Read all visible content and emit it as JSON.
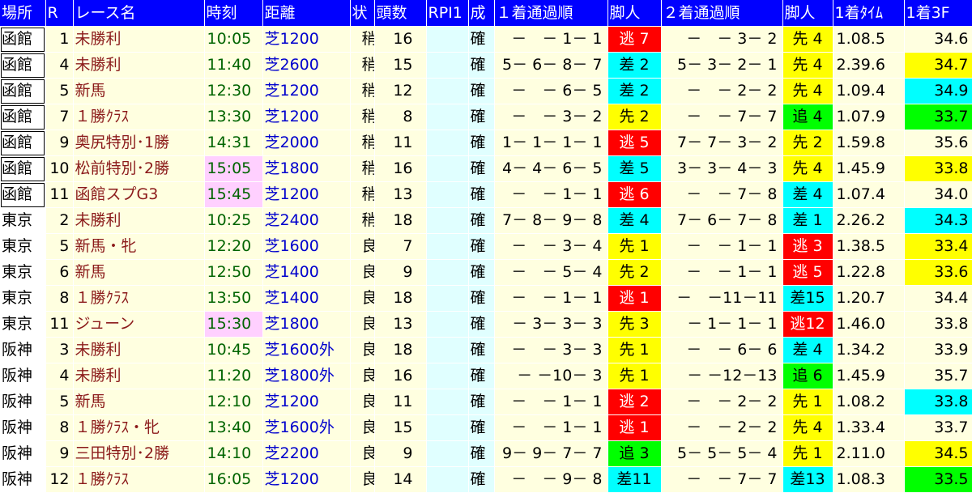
{
  "headers": [
    "場所",
    "R",
    "レース名",
    "時刻",
    "距離",
    "状",
    "頭数",
    "RPI1",
    "成",
    "１着通過順",
    "脚人",
    "２着通過順",
    "脚人",
    "1着ﾀｲﾑ",
    "1着3F"
  ],
  "colors": {
    "header_bg": "#0000ff",
    "race_text": "#8b1a1a",
    "time_text": "#006400",
    "dist_text": "#0000cd",
    "escape_red": "#ff0000",
    "front_yellow": "#ffff00",
    "stalk_cyan": "#00ffff",
    "chase_green": "#00ff00",
    "pink_time": "#ffd0ff"
  },
  "rows": [
    {
      "venue": "函館",
      "venue_box": true,
      "r": "1",
      "race": "未勝利",
      "time": "10:05",
      "time_hl": "",
      "dist": "芝1200",
      "cond": "稍",
      "runners": "16",
      "rpi": "",
      "conf": "確",
      "pass1": "－　－ 1－ 1",
      "style1": "逃 7",
      "style1_c": "red",
      "pass2": "－　－ 3－ 2",
      "style2": "先 4",
      "style2_c": "yellow",
      "winTime": "1.08.5",
      "last3": "34.6",
      "last3_c": ""
    },
    {
      "venue": "函館",
      "venue_box": true,
      "r": "4",
      "race": "未勝利",
      "time": "11:40",
      "time_hl": "",
      "dist": "芝2600",
      "cond": "稍",
      "runners": "15",
      "rpi": "",
      "conf": "確",
      "pass1": "5－ 6－ 8－ 7",
      "style1": "差 2",
      "style1_c": "cyan",
      "pass2": "5－ 3－ 2－ 1",
      "style2": "先 4",
      "style2_c": "yellow",
      "winTime": "2.39.6",
      "last3": "34.7",
      "last3_c": "yellow"
    },
    {
      "venue": "函館",
      "venue_box": true,
      "r": "5",
      "race": "新馬",
      "time": "12:30",
      "time_hl": "",
      "dist": "芝1200",
      "cond": "稍",
      "runners": "12",
      "rpi": "",
      "conf": "確",
      "pass1": "－　－ 6－ 5",
      "style1": "差 2",
      "style1_c": "cyan",
      "pass2": "－　－ 2－ 2",
      "style2": "先 4",
      "style2_c": "yellow",
      "winTime": "1.09.4",
      "last3": "34.9",
      "last3_c": "cyan"
    },
    {
      "venue": "函館",
      "venue_box": true,
      "r": "7",
      "race": "１勝ｸﾗｽ",
      "time": "13:30",
      "time_hl": "",
      "dist": "芝1200",
      "cond": "稍",
      "runners": "8",
      "rpi": "",
      "conf": "確",
      "pass1": "－　－ 3－ 2",
      "style1": "先 2",
      "style1_c": "yellow",
      "pass2": "－　－ 7－ 7",
      "style2": "追 4",
      "style2_c": "green",
      "winTime": "1.07.9",
      "last3": "33.7",
      "last3_c": "green"
    },
    {
      "venue": "函館",
      "venue_box": true,
      "r": "9",
      "race": "奥尻特別･1勝",
      "time": "14:31",
      "time_hl": "",
      "dist": "芝2000",
      "cond": "稍",
      "runners": "11",
      "rpi": "",
      "conf": "確",
      "pass1": "1－ 1－ 1－ 1",
      "style1": "逃 5",
      "style1_c": "red",
      "pass2": "7－ 7－ 3－ 2",
      "style2": "先 2",
      "style2_c": "yellow",
      "winTime": "1.59.8",
      "last3": "35.6",
      "last3_c": ""
    },
    {
      "venue": "函館",
      "venue_box": true,
      "r": "10",
      "race": "松前特別･2勝",
      "time": "15:05",
      "time_hl": "pink",
      "dist": "芝1800",
      "cond": "稍",
      "runners": "16",
      "rpi": "",
      "conf": "確",
      "pass1": "4－ 4－ 6－ 5",
      "style1": "差 5",
      "style1_c": "cyan",
      "pass2": "3－ 3－ 4－ 3",
      "style2": "先 4",
      "style2_c": "yellow",
      "winTime": "1.45.9",
      "last3": "33.8",
      "last3_c": "yellow"
    },
    {
      "venue": "函館",
      "venue_box": true,
      "r": "11",
      "race": "函館スプG3",
      "time": "15:45",
      "time_hl": "pink",
      "dist": "芝1200",
      "cond": "稍",
      "runners": "13",
      "rpi": "",
      "conf": "確",
      "pass1": "－　－ 1－ 1",
      "style1": "逃 6",
      "style1_c": "red",
      "pass2": "－　－ 7－ 8",
      "style2": "差 4",
      "style2_c": "cyan",
      "winTime": "1.07.4",
      "last3": "34.0",
      "last3_c": ""
    },
    {
      "venue": "東京",
      "venue_box": false,
      "r": "2",
      "race": "未勝利",
      "time": "10:25",
      "time_hl": "",
      "dist": "芝2400",
      "cond": "稍",
      "runners": "18",
      "rpi": "",
      "conf": "確",
      "pass1": "7－ 8－ 9－ 8",
      "style1": "差 4",
      "style1_c": "cyan",
      "pass2": "7－ 6－ 7－ 8",
      "style2": "差 1",
      "style2_c": "cyan",
      "winTime": "2.26.2",
      "last3": "34.3",
      "last3_c": "cyan"
    },
    {
      "venue": "東京",
      "venue_box": false,
      "r": "5",
      "race": "新馬・牝",
      "time": "12:20",
      "time_hl": "",
      "dist": "芝1600",
      "cond": "良",
      "runners": "7",
      "rpi": "",
      "conf": "確",
      "pass1": "－　－ 3－ 4",
      "style1": "先 1",
      "style1_c": "yellow",
      "pass2": "－　－ 1－ 1",
      "style2": "逃 3",
      "style2_c": "red",
      "winTime": "1.38.5",
      "last3": "33.4",
      "last3_c": "yellow"
    },
    {
      "venue": "東京",
      "venue_box": false,
      "r": "6",
      "race": "新馬",
      "time": "12:50",
      "time_hl": "",
      "dist": "芝1400",
      "cond": "良",
      "runners": "9",
      "rpi": "",
      "conf": "確",
      "pass1": "－　－ 5－ 4",
      "style1": "先 2",
      "style1_c": "yellow",
      "pass2": "－　－ 1－ 1",
      "style2": "逃 5",
      "style2_c": "red",
      "winTime": "1.22.8",
      "last3": "33.6",
      "last3_c": "yellow"
    },
    {
      "venue": "東京",
      "venue_box": false,
      "r": "8",
      "race": "１勝ｸﾗｽ",
      "time": "13:50",
      "time_hl": "",
      "dist": "芝1400",
      "cond": "良",
      "runners": "18",
      "rpi": "",
      "conf": "確",
      "pass1": "－　－ 1－ 1",
      "style1": "逃 1",
      "style1_c": "red",
      "pass2": "－　－11－11",
      "style2": "差15",
      "style2_c": "cyan",
      "winTime": "1.20.7",
      "last3": "34.4",
      "last3_c": ""
    },
    {
      "venue": "東京",
      "venue_box": false,
      "r": "11",
      "race": "ジューン",
      "time": "15:30",
      "time_hl": "pink",
      "dist": "芝1800",
      "cond": "良",
      "runners": "13",
      "rpi": "",
      "conf": "確",
      "pass1": "－ 3－ 3－ 3",
      "style1": "先 3",
      "style1_c": "yellow",
      "pass2": "－ 1－ 1－ 1",
      "style2": "逃12",
      "style2_c": "red",
      "winTime": "1.46.0",
      "last3": "33.8",
      "last3_c": ""
    },
    {
      "venue": "阪神",
      "venue_box": false,
      "r": "3",
      "race": "未勝利",
      "time": "10:45",
      "time_hl": "",
      "dist": "芝1600外",
      "cond": "良",
      "runners": "18",
      "rpi": "",
      "conf": "確",
      "pass1": "－　－ 3－ 3",
      "style1": "先 1",
      "style1_c": "yellow",
      "pass2": "－　－ 6－ 6",
      "style2": "差 4",
      "style2_c": "cyan",
      "winTime": "1.34.2",
      "last3": "33.9",
      "last3_c": ""
    },
    {
      "venue": "阪神",
      "venue_box": false,
      "r": "4",
      "race": "未勝利",
      "time": "11:20",
      "time_hl": "",
      "dist": "芝1800外",
      "cond": "良",
      "runners": "16",
      "rpi": "",
      "conf": "確",
      "pass1": "－ －10－ 3",
      "style1": "先 1",
      "style1_c": "yellow",
      "pass2": "－ －12－13",
      "style2": "追 6",
      "style2_c": "green",
      "winTime": "1.45.9",
      "last3": "35.7",
      "last3_c": ""
    },
    {
      "venue": "阪神",
      "venue_box": false,
      "r": "5",
      "race": "新馬",
      "time": "12:10",
      "time_hl": "",
      "dist": "芝1200",
      "cond": "良",
      "runners": "11",
      "rpi": "",
      "conf": "確",
      "pass1": "－　－ 1－ 1",
      "style1": "逃 2",
      "style1_c": "red",
      "pass2": "－　－ 2－ 2",
      "style2": "先 1",
      "style2_c": "yellow",
      "winTime": "1.08.2",
      "last3": "33.8",
      "last3_c": "cyan"
    },
    {
      "venue": "阪神",
      "venue_box": false,
      "r": "8",
      "race": "１勝ｸﾗｽ・牝",
      "time": "13:40",
      "time_hl": "",
      "dist": "芝1600外",
      "cond": "良",
      "runners": "15",
      "rpi": "",
      "conf": "確",
      "pass1": "－　－ 1－ 1",
      "style1": "逃 1",
      "style1_c": "red",
      "pass2": "－　－ 2－ 2",
      "style2": "先 4",
      "style2_c": "yellow",
      "winTime": "1.33.4",
      "last3": "33.7",
      "last3_c": ""
    },
    {
      "venue": "阪神",
      "venue_box": false,
      "r": "9",
      "race": "三田特別･2勝",
      "time": "14:10",
      "time_hl": "",
      "dist": "芝2200",
      "cond": "良",
      "runners": "9",
      "rpi": "",
      "conf": "確",
      "pass1": "9－ 9－ 7－ 7",
      "style1": "追 3",
      "style1_c": "green",
      "pass2": "5－ 5－ 5－ 4",
      "style2": "先 1",
      "style2_c": "yellow",
      "winTime": "2.11.0",
      "last3": "34.5",
      "last3_c": "yellow"
    },
    {
      "venue": "阪神",
      "venue_box": false,
      "r": "12",
      "race": "１勝ｸﾗｽ",
      "time": "16:05",
      "time_hl": "",
      "dist": "芝1200",
      "cond": "良",
      "runners": "14",
      "rpi": "",
      "conf": "確",
      "pass1": "－　－ 9－ 8",
      "style1": "差11",
      "style1_c": "cyan",
      "pass2": "－　－ 7－ 7",
      "style2": "差13",
      "style2_c": "cyan",
      "winTime": "1.08.3",
      "last3": "33.5",
      "last3_c": "green"
    }
  ]
}
